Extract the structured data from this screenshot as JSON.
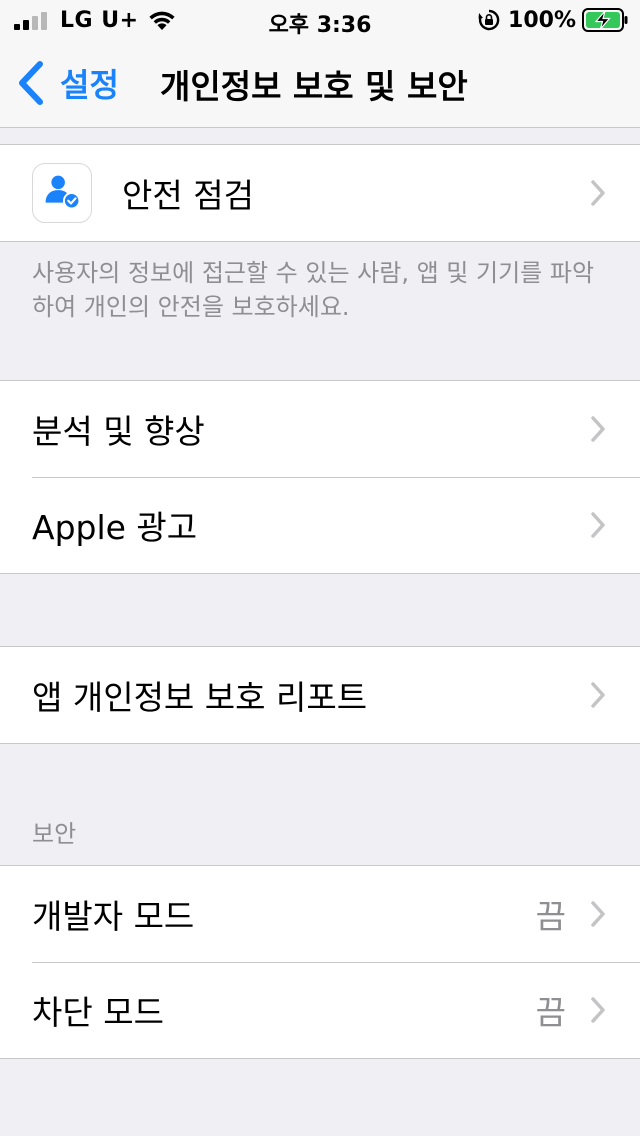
{
  "status_bar": {
    "carrier": "LG U+",
    "time": "오후 3:36",
    "battery_percent": "100%"
  },
  "nav": {
    "back_label": "설정",
    "title": "개인정보 보호 및 보안"
  },
  "safety_group": {
    "items": [
      {
        "label": "안전 점검",
        "icon": "person-check-icon"
      }
    ],
    "footer": "사용자의 정보에 접근할 수 있는 사람, 앱 및 기기를 파악하여 개인의 안전을 보호하세요."
  },
  "analytics_group": {
    "items": [
      {
        "label": "분석 및 향상"
      },
      {
        "label": "Apple 광고"
      }
    ]
  },
  "report_group": {
    "items": [
      {
        "label": "앱 개인정보 보호 리포트"
      }
    ]
  },
  "security_group": {
    "header": "보안",
    "items": [
      {
        "label": "개발자 모드",
        "value": "끔"
      },
      {
        "label": "차단 모드",
        "value": "끔"
      }
    ]
  },
  "colors": {
    "accent": "#1a82fb",
    "background": "#efeff4",
    "secondary_text": "#8e8e93",
    "battery_charging": "#34c759"
  }
}
